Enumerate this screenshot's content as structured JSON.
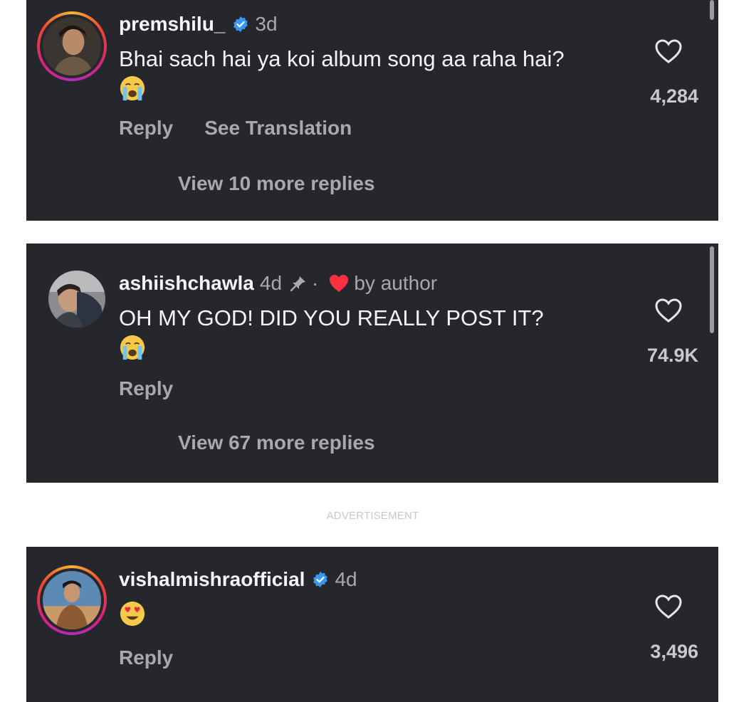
{
  "comments": [
    {
      "username": "premshilu_",
      "verified": true,
      "age": "3d",
      "text": "Bhai sach hai ya koi album song aa raha hai?",
      "emoji": "crying-face",
      "likes": "4,284",
      "actions": [
        "Reply",
        "See Translation"
      ],
      "more_replies": "View 10 more replies"
    },
    {
      "username": "ashiishchawla",
      "verified": false,
      "age": "4d",
      "pinned": true,
      "separator": "·",
      "author_liked": "by author",
      "text": "OH MY GOD! DID YOU REALLY POST IT?",
      "emoji": "crying-face",
      "likes": "74.9K",
      "actions": [
        "Reply"
      ],
      "more_replies": "View 67 more replies"
    },
    {
      "username": "vishalmishraofficial",
      "verified": true,
      "age": "4d",
      "text": "",
      "emoji": "heart-eyes-face",
      "likes": "3,496",
      "actions": [
        "Reply"
      ]
    }
  ],
  "advertisement_label": "ADVERTISEMENT",
  "colors": {
    "card_background": "#26272c",
    "primary_text": "#f5f5f5",
    "secondary_text": "#a8a8ad",
    "verified_blue": "#3897f0",
    "author_heart_red": "#ff3040"
  },
  "icons": [
    "verified-badge-icon",
    "like-heart-icon",
    "pin-icon",
    "crying-face-emoji",
    "heart-eyes-emoji"
  ]
}
